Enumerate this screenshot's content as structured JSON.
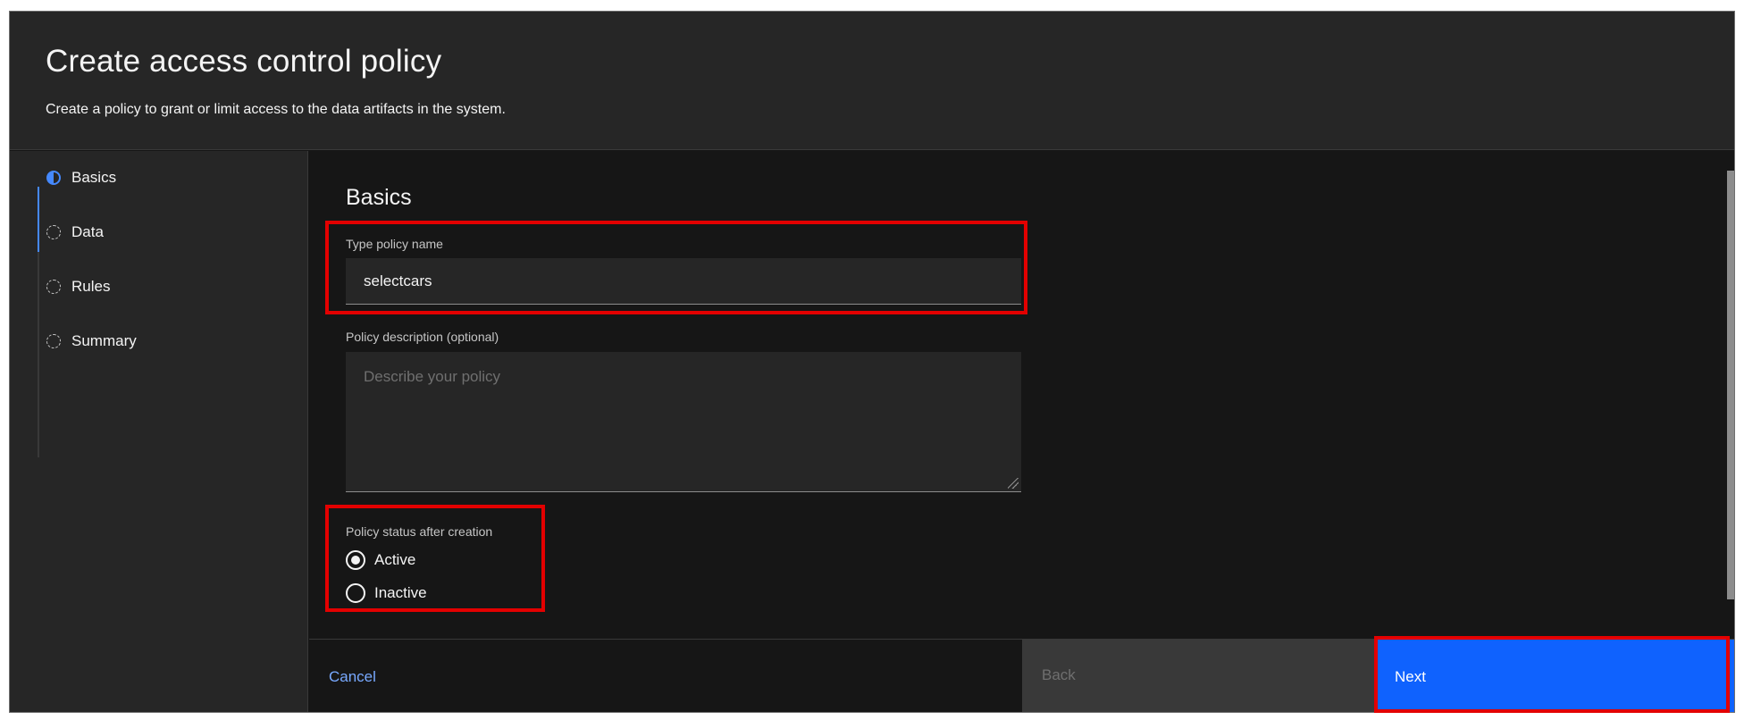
{
  "modal": {
    "title": "Create access control policy",
    "subtitle": "Create a policy to grant or limit access to the data artifacts in the system."
  },
  "steps": [
    {
      "label": "Basics",
      "state": "current"
    },
    {
      "label": "Data",
      "state": "incomplete"
    },
    {
      "label": "Rules",
      "state": "incomplete"
    },
    {
      "label": "Summary",
      "state": "incomplete"
    }
  ],
  "form": {
    "section_title": "Basics",
    "policy_name": {
      "label": "Type policy name",
      "value": "selectcars"
    },
    "description": {
      "label": "Policy description (optional)",
      "placeholder": "Describe your policy",
      "value": ""
    },
    "status": {
      "label": "Policy status after creation",
      "options": [
        {
          "label": "Active",
          "checked": true
        },
        {
          "label": "Inactive",
          "checked": false
        }
      ]
    }
  },
  "footer": {
    "cancel_label": "Cancel",
    "back_label": "Back",
    "next_label": "Next"
  },
  "colors": {
    "accent": "#0f62fe",
    "link": "#78a9ff",
    "highlight": "#e30000",
    "background": "#161616"
  }
}
